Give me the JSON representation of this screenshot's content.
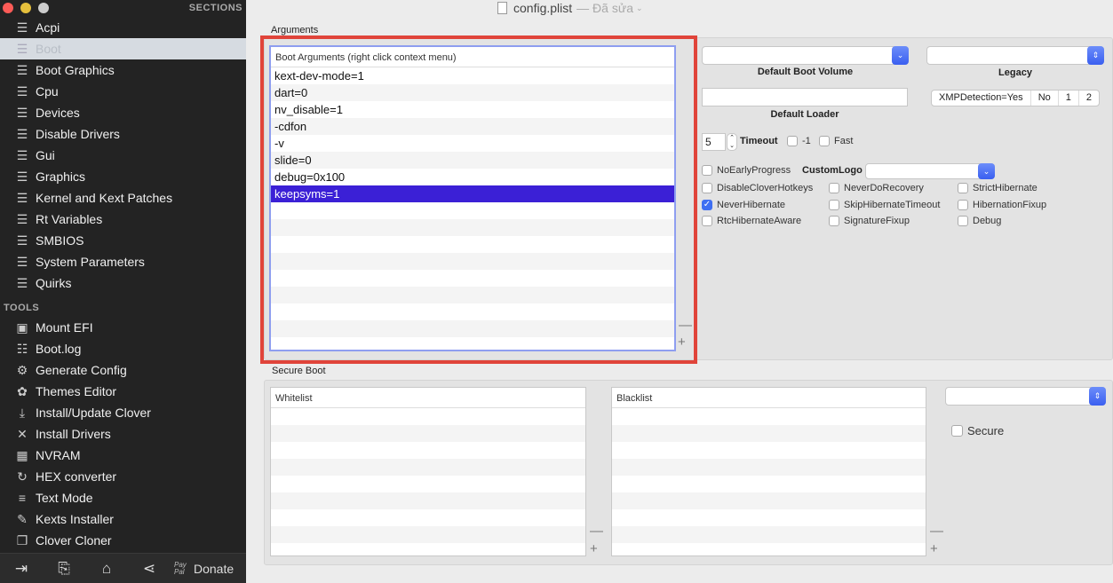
{
  "window": {
    "title": "config.plist",
    "status": "— Đã sửa"
  },
  "sidebar": {
    "sections_heading": "SECTIONS",
    "sections": [
      {
        "label": "Acpi",
        "icon": "list-icon"
      },
      {
        "label": "Boot",
        "icon": "list-icon",
        "selected": true
      },
      {
        "label": "Boot Graphics",
        "icon": "list-icon"
      },
      {
        "label": "Cpu",
        "icon": "list-icon"
      },
      {
        "label": "Devices",
        "icon": "list-icon"
      },
      {
        "label": "Disable Drivers",
        "icon": "list-icon"
      },
      {
        "label": "Gui",
        "icon": "list-icon"
      },
      {
        "label": "Graphics",
        "icon": "list-icon"
      },
      {
        "label": "Kernel and Kext Patches",
        "icon": "list-icon"
      },
      {
        "label": "Rt Variables",
        "icon": "list-icon"
      },
      {
        "label": "SMBIOS",
        "icon": "list-icon"
      },
      {
        "label": "System Parameters",
        "icon": "list-icon"
      },
      {
        "label": "Quirks",
        "icon": "list-icon"
      }
    ],
    "tools_heading": "TOOLS",
    "tools": [
      {
        "label": "Mount EFI",
        "icon": "disk-icon"
      },
      {
        "label": "Boot.log",
        "icon": "log-search-icon"
      },
      {
        "label": "Generate Config",
        "icon": "gears-icon"
      },
      {
        "label": "Themes Editor",
        "icon": "palette-icon"
      },
      {
        "label": "Install/Update Clover",
        "icon": "download-icon"
      },
      {
        "label": "Install Drivers",
        "icon": "tools-icon"
      },
      {
        "label": "NVRAM",
        "icon": "chip-icon"
      },
      {
        "label": "HEX converter",
        "icon": "refresh-icon"
      },
      {
        "label": "Text Mode",
        "icon": "text-icon"
      },
      {
        "label": "Kexts Installer",
        "icon": "plug-icon"
      },
      {
        "label": "Clover Cloner",
        "icon": "copy-icon"
      }
    ],
    "bottom": {
      "donate_label": "Donate",
      "paypal": "Pay Pal"
    }
  },
  "arguments": {
    "group_label": "Arguments",
    "table_header": "Boot Arguments (right click context menu)",
    "items": [
      "kext-dev-mode=1",
      "dart=0",
      "nv_disable=1",
      "-cdfon",
      "-v",
      "slide=0",
      "debug=0x100",
      "keepsyms=1"
    ],
    "selected_index": 7
  },
  "controls": {
    "default_boot_volume_label": "Default Boot Volume",
    "default_boot_volume": "",
    "legacy_label": "Legacy",
    "legacy": "",
    "default_loader_label": "Default Loader",
    "default_loader": "",
    "xmp_segments": [
      "XMPDetection=Yes",
      "No",
      "1",
      "2"
    ],
    "timeout_value": "5",
    "timeout_label": "Timeout",
    "minus_one_label": "-1",
    "fast_label": "Fast",
    "custom_logo_label": "CustomLogo",
    "custom_logo": "",
    "checkboxes": [
      {
        "label": "NoEarlyProgress",
        "checked": false
      },
      {
        "label": "DisableCloverHotkeys",
        "checked": false
      },
      {
        "label": "NeverDoRecovery",
        "checked": false
      },
      {
        "label": "StrictHibernate",
        "checked": false
      },
      {
        "label": "NeverHibernate",
        "checked": true
      },
      {
        "label": "SkipHibernateTimeout",
        "checked": false
      },
      {
        "label": "HibernationFixup",
        "checked": false
      },
      {
        "label": "RtcHibernateAware",
        "checked": false
      },
      {
        "label": "SignatureFixup",
        "checked": false
      },
      {
        "label": "Debug",
        "checked": false
      }
    ]
  },
  "secure_boot": {
    "group_label": "Secure Boot",
    "whitelist_header": "Whitelist",
    "blacklist_header": "Blacklist",
    "policy": "",
    "secure_label": "Secure",
    "secure_checked": false
  },
  "colors": {
    "selection": "#3b20d6",
    "highlight_border": "#e0443a",
    "sidebar_bg": "#232323"
  }
}
